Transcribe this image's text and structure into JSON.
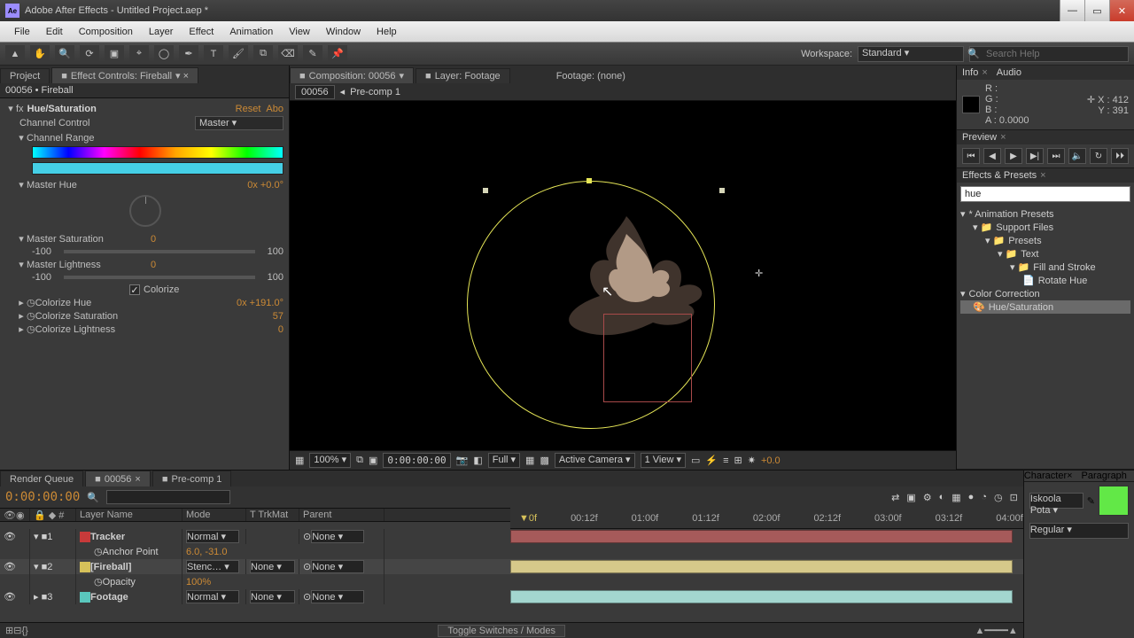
{
  "title": "Adobe After Effects - Untitled Project.aep *",
  "menu": [
    "File",
    "Edit",
    "Composition",
    "Layer",
    "Effect",
    "Animation",
    "View",
    "Window",
    "Help"
  ],
  "workspace": {
    "label": "Workspace:",
    "value": "Standard"
  },
  "search_help_placeholder": "Search Help",
  "left_tabs": {
    "project": "Project",
    "effect_controls": "Effect Controls: Fireball"
  },
  "panel_header": "00056 • Fireball",
  "fx": {
    "name": "Hue/Saturation",
    "reset": "Reset",
    "about": "Abo",
    "channel_control": {
      "label": "Channel Control",
      "value": "Master"
    },
    "channel_range": "Channel Range",
    "master_hue": {
      "label": "Master Hue",
      "value": "0x +0.0°"
    },
    "master_sat": {
      "label": "Master Saturation",
      "value": "0",
      "min": "-100",
      "max": "100"
    },
    "master_light": {
      "label": "Master Lightness",
      "value": "0",
      "min": "-100",
      "max": "100"
    },
    "colorize_label": "Colorize",
    "colorize_checked": true,
    "colorize_hue": {
      "label": "Colorize Hue",
      "value": "0x +191.0°"
    },
    "colorize_sat": {
      "label": "Colorize Saturation",
      "value": "57"
    },
    "colorize_light": {
      "label": "Colorize Lightness",
      "value": "0"
    }
  },
  "comp_tabs": {
    "composition": "Composition: 00056",
    "layer": "Layer: Footage",
    "footage": "Footage: (none)"
  },
  "comp_nav": {
    "current": "00056",
    "parent": "Pre-comp 1"
  },
  "viewer_controls": {
    "zoom": "100%",
    "time": "0:00:00:00",
    "res": "Full",
    "camera": "Active Camera",
    "views": "1 View",
    "exposure": "+0.0"
  },
  "info": {
    "panel": "Info",
    "audio": "Audio",
    "R": "R :",
    "G": "G :",
    "B": "B :",
    "A": "A : 0.0000",
    "X": "X : 412",
    "Y": "Y : 391"
  },
  "preview": {
    "panel": "Preview"
  },
  "ep": {
    "panel": "Effects & Presets",
    "query": "hue",
    "tree": {
      "anim": "* Animation Presets",
      "support": "Support Files",
      "presets": "Presets",
      "text": "Text",
      "fill": "Fill and Stroke",
      "rotate": "Rotate Hue",
      "cc": "Color Correction",
      "hs": "Hue/Saturation"
    }
  },
  "timeline": {
    "tabs": {
      "rq": "Render Queue",
      "c1": "00056",
      "c2": "Pre-comp 1"
    },
    "timecode": "0:00:00:00",
    "cols": {
      "layer_name": "Layer Name",
      "mode": "Mode",
      "trkmat": "TrkMat",
      "parent": "Parent"
    },
    "ruler": [
      "00:12f",
      "01:00f",
      "01:12f",
      "02:00f",
      "02:12f",
      "03:00f",
      "03:12f",
      "04:00f"
    ],
    "layers": [
      {
        "n": "1",
        "name": "Tracker",
        "mode": "Normal",
        "trk": "",
        "parent": "None",
        "prop": "Anchor Point",
        "propval": "6.0, -31.0",
        "color": "#c73a3a"
      },
      {
        "n": "2",
        "name": "Fireball",
        "mode": "Stenc…",
        "trk": "None",
        "parent": "None",
        "prop": "Opacity",
        "propval": "100%",
        "color": "#d6c15a",
        "selected": true
      },
      {
        "n": "3",
        "name": "Footage",
        "mode": "Normal",
        "trk": "None",
        "parent": "None",
        "color": "#5ac7bd"
      }
    ],
    "footer": "Toggle Switches / Modes"
  },
  "character": {
    "panel": "Character",
    "para": "Paragraph",
    "font": "Iskoola Pota",
    "style": "Regular"
  }
}
